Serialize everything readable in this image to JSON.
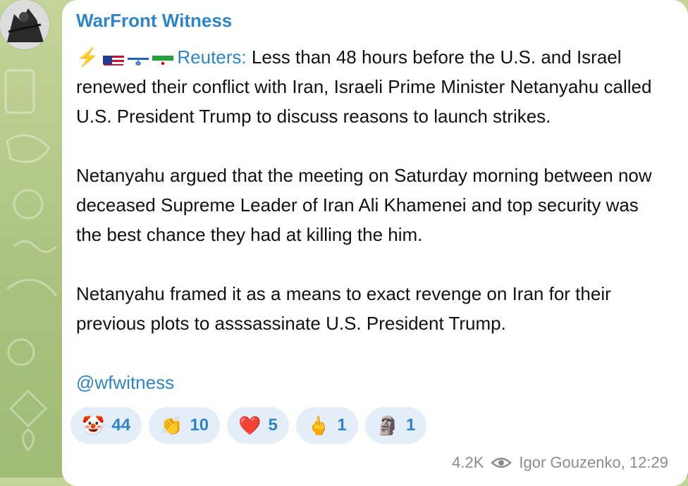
{
  "channel": {
    "name": "WarFront Witness"
  },
  "message": {
    "lead_icons": [
      "lightning-icon",
      "us-flag-icon",
      "israel-flag-icon",
      "iran-flag-icon"
    ],
    "source": "Reuters:",
    "paragraph1": " Less than 48 hours before the U.S. and Israel renewed their conflict with Iran, Israeli Prime Minister Netanyahu called U.S. President Trump to discuss reasons to launch strikes.",
    "paragraph2": "Netanyahu argued that the meeting on Saturday morning between now deceased Supreme Leader of Iran Ali Khamenei and top security was the best chance they had at killing the him.",
    "paragraph3": "Netanyahu framed it as a means to exact revenge on Iran for their previous plots to asssassinate U.S. President Trump.",
    "handle": "@wfwitness"
  },
  "reactions": [
    {
      "emoji": "🤡",
      "icon": "clown-face-icon",
      "count": "44"
    },
    {
      "emoji": "👏",
      "icon": "clapping-hands-icon",
      "count": "10"
    },
    {
      "emoji": "❤️",
      "icon": "red-heart-icon",
      "count": "5"
    },
    {
      "emoji": "🖕",
      "icon": "middle-finger-icon",
      "count": "1"
    },
    {
      "emoji": "🗿",
      "icon": "moai-icon",
      "count": "1"
    }
  ],
  "footer": {
    "views": "4.2K",
    "author_time": "Igor Gouzenko, 12:29"
  },
  "colors": {
    "link": "#2f84c7",
    "reaction_bg": "#e3eef8",
    "bubble": "#ffffff",
    "wallpaper": "#b9cf8f"
  }
}
